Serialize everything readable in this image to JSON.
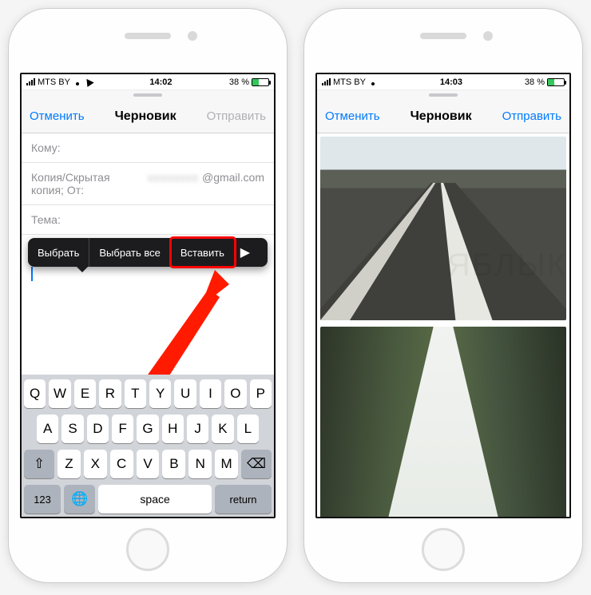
{
  "left": {
    "status": {
      "carrier": "MTS BY",
      "time": "14:02",
      "battery_pct": "38 %"
    },
    "nav": {
      "cancel": "Отменить",
      "title": "Черновик",
      "send": "Отправить",
      "send_disabled": true
    },
    "fields": {
      "to_label": "Кому:",
      "cc_label": "Копия/Скрытая копия; От:",
      "cc_value_suffix": "@gmail.com",
      "subject_label": "Тема:"
    },
    "context_menu": {
      "select": "Выбрать",
      "select_all": "Выбрать все",
      "paste": "Вставить",
      "more_arrow": "▶"
    },
    "keyboard": {
      "row1": [
        "Q",
        "W",
        "E",
        "R",
        "T",
        "Y",
        "U",
        "I",
        "O",
        "P"
      ],
      "row2": [
        "A",
        "S",
        "D",
        "F",
        "G",
        "H",
        "J",
        "K",
        "L"
      ],
      "row3": [
        "Z",
        "X",
        "C",
        "V",
        "B",
        "N",
        "M"
      ],
      "shift": "⇧",
      "delete": "⌫",
      "num": "123",
      "globe": "🌐",
      "space": "space",
      "return": "return"
    }
  },
  "right": {
    "status": {
      "carrier": "MTS BY",
      "time": "14:03",
      "battery_pct": "38 %"
    },
    "nav": {
      "cancel": "Отменить",
      "title": "Черновик",
      "send": "Отправить",
      "send_disabled": false
    },
    "images": [
      {
        "desc": "curved asphalt road with white lane markings, stone wall, overcast sky"
      },
      {
        "desc": "narrow canyon with steep green cliff walls and bright sky gap"
      }
    ]
  },
  "watermark": "ЯБЛЫК"
}
